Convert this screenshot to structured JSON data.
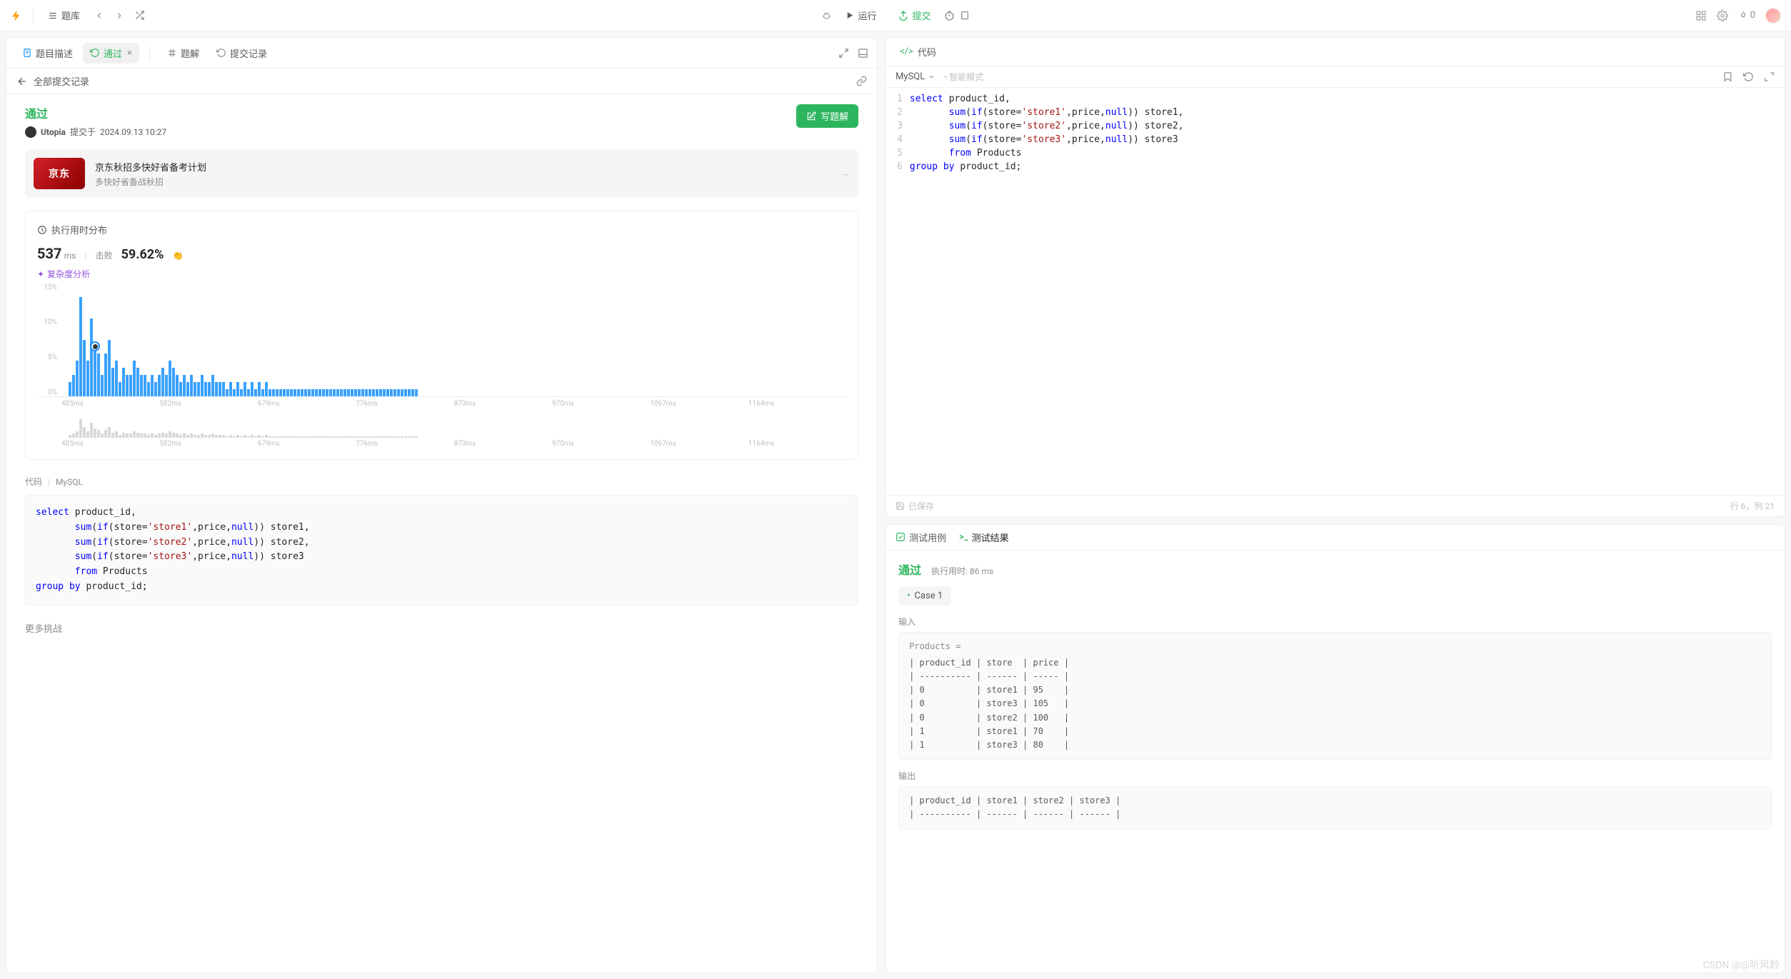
{
  "topbar": {
    "problems_label": "题库",
    "run_label": "运行",
    "submit_label": "提交",
    "streak_count": "0"
  },
  "left": {
    "tabs": {
      "desc": "题目描述",
      "pass": "通过",
      "solution": "题解",
      "history": "提交记录"
    },
    "sub_header": "全部提交记录",
    "pass_title": "通过",
    "user": "Utopia",
    "submitted_prefix": "提交于",
    "submitted_at": "2024.09.13 10:27",
    "write_solution": "写题解",
    "promo": {
      "logo": "京东",
      "t1": "京东秋招多快好省备考计划",
      "t2": "多快好省备战秋招"
    },
    "runtime_card": {
      "title": "执行用时分布",
      "value": "537",
      "unit": "ms",
      "beats_label": "击败",
      "beats_pct": "59.62%",
      "complexity": "复杂度分析"
    },
    "code_section": {
      "label": "代码",
      "lang": "MySQL"
    },
    "more": "更多挑战"
  },
  "right": {
    "code_tab": "代码",
    "lang": "MySQL",
    "smart": "智能模式",
    "saved": "已保存",
    "cursor": "行 6，列 21",
    "code_lines": [
      {
        "n": 1,
        "html": "<span class='kw'>select</span> product_id,"
      },
      {
        "n": 2,
        "html": "       <span class='kw'>sum</span>(<span class='kw'>if</span>(store=<span class='str'>'store1'</span>,price,<span class='kwnull'>null</span>)) store1,"
      },
      {
        "n": 3,
        "html": "       <span class='kw'>sum</span>(<span class='kw'>if</span>(store=<span class='str'>'store2'</span>,price,<span class='kwnull'>null</span>)) store2,"
      },
      {
        "n": 4,
        "html": "       <span class='kw'>sum</span>(<span class='kw'>if</span>(store=<span class='str'>'store3'</span>,price,<span class='kwnull'>null</span>)) store3"
      },
      {
        "n": 5,
        "html": "       <span class='kw'>from</span> Products"
      },
      {
        "n": 6,
        "html": "<span class='kw'>group</span> <span class='kw'>by</span> product_id;"
      }
    ]
  },
  "result": {
    "tab_cases": "测试用例",
    "tab_result": "测试结果",
    "pass": "通过",
    "runtime_label": "执行用时: 86 ms",
    "case1": "Case 1",
    "input_label": "输入",
    "output_label": "输出",
    "input_header": "Products =",
    "input_table": "| product_id | store  | price |\n| ---------- | ------ | ----- |\n| 0          | store1 | 95    |\n| 0          | store3 | 105   |\n| 0          | store2 | 100   |\n| 1          | store1 | 70    |\n| 1          | store3 | 80    |",
    "output_table": "| product_id | store1 | store2 | store3 |\n| ---------- | ------ | ------ | ------ |"
  },
  "chart_data": {
    "type": "bar",
    "title": "执行用时分布",
    "xlabel": "ms",
    "ylabel": "%",
    "ylim": [
      0,
      15
    ],
    "yticks": [
      "0%",
      "5%",
      "10%",
      "15%"
    ],
    "xticks": [
      "485ms",
      "582ms",
      "679ms",
      "776ms",
      "873ms",
      "970ms",
      "1067ms",
      "1164ms"
    ],
    "values": [
      0,
      0,
      2,
      3,
      5,
      14,
      8,
      5,
      11,
      7,
      6,
      3,
      6,
      8,
      4,
      5,
      2,
      4,
      3,
      3,
      5,
      4,
      3,
      3,
      2,
      3,
      2,
      3,
      4,
      3,
      5,
      4,
      3,
      2,
      3,
      2,
      3,
      2,
      2,
      3,
      2,
      2,
      3,
      2,
      2,
      2,
      1,
      2,
      1,
      2,
      1,
      2,
      1,
      2,
      1,
      2,
      1,
      2,
      1,
      1,
      1,
      1,
      1,
      1,
      1,
      1,
      1,
      1,
      1,
      1,
      1,
      1,
      1,
      1,
      1,
      1,
      1,
      1,
      1,
      1,
      1,
      1,
      1,
      1,
      1,
      1,
      1,
      1,
      1,
      1,
      1,
      1,
      1,
      1,
      1,
      1,
      1,
      1,
      1,
      1
    ],
    "marker_index": 9
  },
  "watermark": "CSDN @@听风聆"
}
